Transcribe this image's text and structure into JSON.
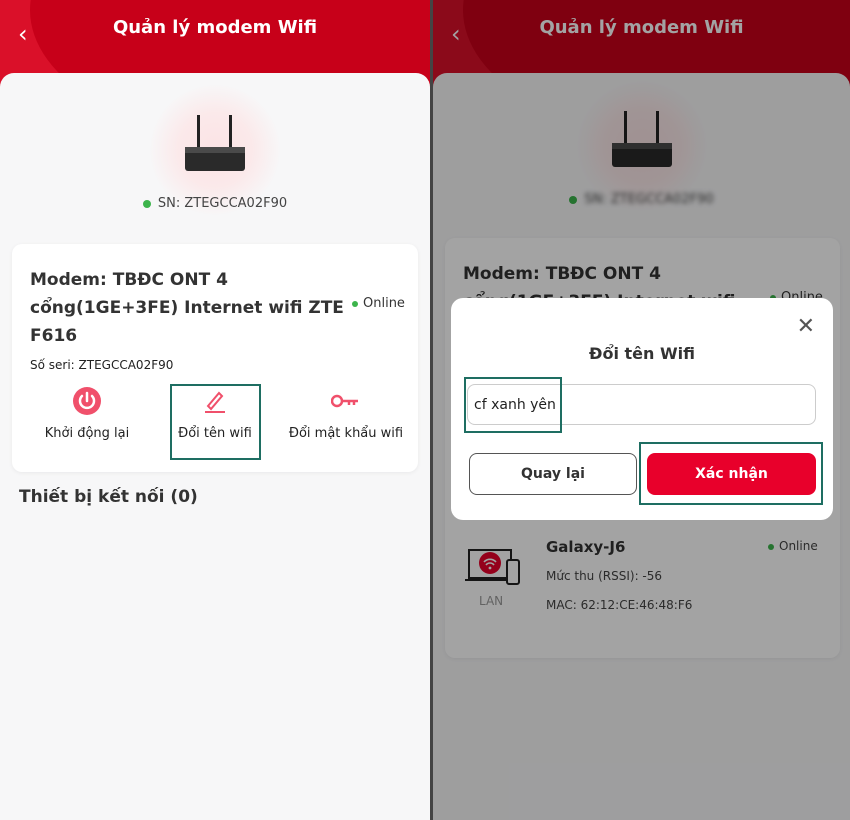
{
  "header": {
    "title": "Quản lý modem Wifi",
    "back_icon": "chevron-left-icon"
  },
  "colors": {
    "brand_red": "#d0021b",
    "confirm_red": "#e8002b",
    "online_green": "#3cb44b",
    "highlight": "#1e6e62"
  },
  "modem": {
    "sn_label": "SN: ZTEGCCA02F90",
    "name": "Modem: TBĐC ONT 4 cổng(1GE+3FE) Internet wifi ZTE F616",
    "status": "Online",
    "serial_label": "Số seri: ZTEGCCA02F90"
  },
  "actions": [
    {
      "label": "Khởi động lại",
      "icon": "power-icon"
    },
    {
      "label": "Đổi tên wifi",
      "icon": "pencil-icon"
    },
    {
      "label": "Đổi mật khẩu wifi",
      "icon": "key-icon"
    }
  ],
  "connected": {
    "title": "Thiết bị kết nối (0)"
  },
  "dialog": {
    "title": "Đổi tên Wifi",
    "input_value": "cf xanh yên",
    "cancel": "Quay lại",
    "confirm": "Xác nhận",
    "close_icon": "close-icon"
  },
  "device": {
    "name": "Galaxy-J6",
    "status": "Online",
    "rssi": "Mức thu (RSSI): -56",
    "mac": "MAC: 62:12:CE:46:48:F6",
    "type": "LAN"
  }
}
